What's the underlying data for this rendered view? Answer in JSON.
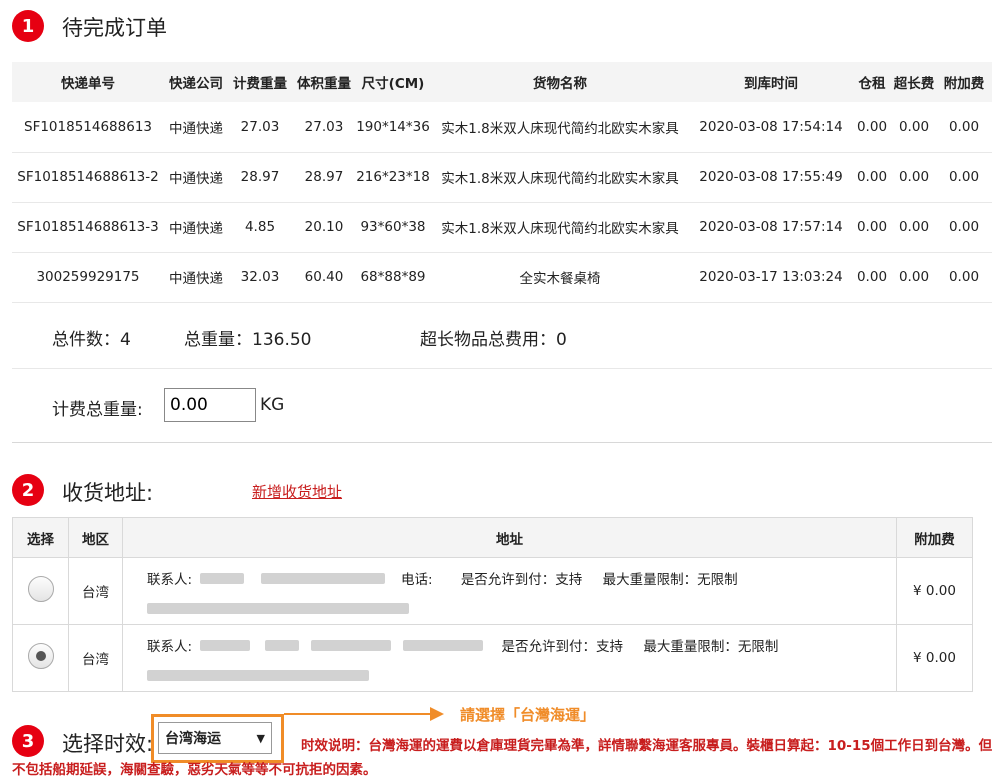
{
  "section1": {
    "step": "1",
    "title": "待完成订单",
    "columns": [
      "快递单号",
      "快递公司",
      "计费重量",
      "体积重量",
      "尺寸(CM)",
      "货物名称",
      "到库时间",
      "仓租",
      "超长费",
      "附加费"
    ],
    "rows": [
      [
        "SF1018514688613",
        "中通快递",
        "27.03",
        "27.03",
        "190*14*36",
        "实木1.8米双人床现代简约北欧实木家具",
        "2020-03-08 17:54:14",
        "0.00",
        "0.00",
        "0.00"
      ],
      [
        "SF1018514688613-2",
        "中通快递",
        "28.97",
        "28.97",
        "216*23*18",
        "实木1.8米双人床现代简约北欧实木家具",
        "2020-03-08 17:55:49",
        "0.00",
        "0.00",
        "0.00"
      ],
      [
        "SF1018514688613-3",
        "中通快递",
        "4.85",
        "20.10",
        "93*60*38",
        "实木1.8米双人床现代简约北欧实木家具",
        "2020-03-08 17:57:14",
        "0.00",
        "0.00",
        "0.00"
      ],
      [
        "300259929175",
        "中通快递",
        "32.03",
        "60.40",
        "68*88*89",
        "全实木餐桌椅",
        "2020-03-17 13:03:24",
        "0.00",
        "0.00",
        "0.00"
      ]
    ],
    "total_count": "总件数：4",
    "total_weight": "总重量：136.50",
    "overlength_total": "超长物品总费用：0",
    "billing_weight_label": "计费总重量:",
    "billing_weight_value": "0.00",
    "billing_weight_unit": "KG"
  },
  "section2": {
    "step": "2",
    "title": "收货地址:",
    "add_link": "新增收货地址",
    "columns": [
      "选择",
      "地区",
      "地址",
      "附加费"
    ],
    "rows": [
      {
        "checked": false,
        "region": "台湾",
        "contact_label": "联系人:",
        "phone_label": "电话:",
        "cod": "是否允许到付：支持",
        "max_weight": "最大重量限制：无限制",
        "fee": "¥ 0.00"
      },
      {
        "checked": true,
        "region": "台湾",
        "contact_label": "联系人:",
        "phone_label": "",
        "cod": "是否允许到付：支持",
        "max_weight": "最大重量限制：无限制",
        "fee": "¥ 0.00"
      }
    ]
  },
  "section3": {
    "step": "3",
    "title": "选择时效:",
    "selected_option": "台湾海运",
    "hint": "請選擇「台灣海運」",
    "note": "时效说明：台灣海運的運費以倉庫理貨完畢為準，詳情聯繫海運客服專員。裝櫃日算起：10-15個工作日到台灣。但不包括船期延誤，海關查驗，惡劣天氣等等不可抗拒的因素。"
  },
  "colors": {
    "accent_red": "#e60012",
    "link_red": "#c81e1e",
    "highlight_orange": "#f08c28"
  }
}
